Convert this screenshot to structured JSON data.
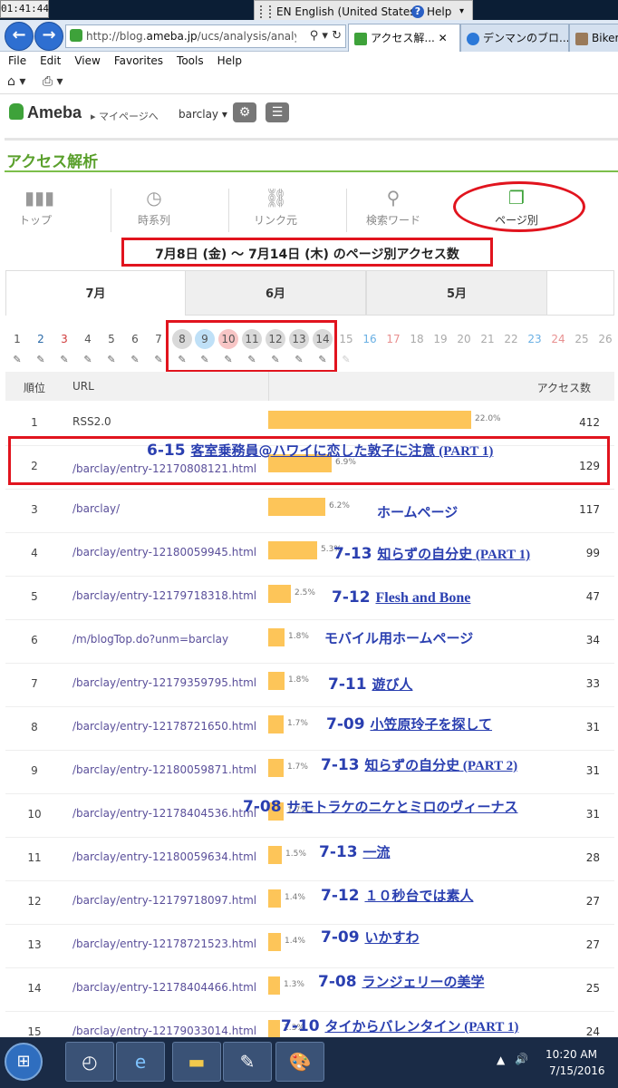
{
  "os": {
    "clock": "01:41:44",
    "language": "EN English (United States)",
    "help": "Help",
    "tray_time": "10:20 AM",
    "tray_date": "7/15/2016"
  },
  "browser": {
    "url_prefix": "http://blog.",
    "url_domain": "ameba.jp",
    "url_rest": "/ucs/analysis/analysis",
    "tabs": [
      "アクセス解...",
      "デンマンのブロ...",
      "Biker"
    ],
    "menu": [
      "File",
      "Edit",
      "View",
      "Favorites",
      "Tools",
      "Help"
    ]
  },
  "ameba": {
    "logo": "Ameba",
    "mypage": "マイページへ",
    "user": "barclay"
  },
  "page": {
    "title": "アクセス解析",
    "nav": [
      "トップ",
      "時系列",
      "リンク元",
      "検索ワード",
      "ページ別"
    ],
    "date_range": "7月8日 (金) 〜 7月14日 (木) のページ別アクセス数",
    "month_tabs": [
      "7月",
      "6月",
      "5月"
    ],
    "days": [
      "1",
      "2",
      "3",
      "4",
      "5",
      "6",
      "7",
      "8",
      "9",
      "10",
      "11",
      "12",
      "13",
      "14",
      "15",
      "16",
      "17",
      "18",
      "19",
      "20",
      "21",
      "22",
      "23",
      "24",
      "25",
      "26"
    ],
    "colors": {
      "accent_green": "#5aa02c",
      "bar": "#fdc559",
      "annotation_blue": "#2a3fb0",
      "highlight_red": "#e1141e"
    }
  },
  "table": {
    "headers": {
      "rank": "順位",
      "url": "URL",
      "count": "アクセス数"
    },
    "rows": [
      {
        "rank": "1",
        "url": "RSS2.0",
        "pct": "22.0%",
        "share": 22.0,
        "count": "412"
      },
      {
        "rank": "2",
        "url": "/barclay/entry-12170808121.html",
        "pct": "6.9%",
        "share": 6.9,
        "count": "129"
      },
      {
        "rank": "3",
        "url": "/barclay/",
        "pct": "6.2%",
        "share": 6.2,
        "count": "117"
      },
      {
        "rank": "4",
        "url": "/barclay/entry-12180059945.html",
        "pct": "5.3%",
        "share": 5.3,
        "count": "99"
      },
      {
        "rank": "5",
        "url": "/barclay/entry-12179718318.html",
        "pct": "2.5%",
        "share": 2.5,
        "count": "47"
      },
      {
        "rank": "6",
        "url": "/m/blogTop.do?unm=barclay",
        "pct": "1.8%",
        "share": 1.8,
        "count": "34"
      },
      {
        "rank": "7",
        "url": "/barclay/entry-12179359795.html",
        "pct": "1.8%",
        "share": 1.8,
        "count": "33"
      },
      {
        "rank": "8",
        "url": "/barclay/entry-12178721650.html",
        "pct": "1.7%",
        "share": 1.7,
        "count": "31"
      },
      {
        "rank": "9",
        "url": "/barclay/entry-12180059871.html",
        "pct": "1.7%",
        "share": 1.7,
        "count": "31"
      },
      {
        "rank": "10",
        "url": "/barclay/entry-12178404536.html",
        "pct": "1.7%",
        "share": 1.7,
        "count": "31"
      },
      {
        "rank": "11",
        "url": "/barclay/entry-12180059634.html",
        "pct": "1.5%",
        "share": 1.5,
        "count": "28"
      },
      {
        "rank": "12",
        "url": "/barclay/entry-12179718097.html",
        "pct": "1.4%",
        "share": 1.4,
        "count": "27"
      },
      {
        "rank": "13",
        "url": "/barclay/entry-12178721523.html",
        "pct": "1.4%",
        "share": 1.4,
        "count": "27"
      },
      {
        "rank": "14",
        "url": "/barclay/entry-12178404466.html",
        "pct": "1.3%",
        "share": 1.3,
        "count": "25"
      },
      {
        "rank": "15",
        "url": "/barclay/entry-12179033014.html",
        "pct": "1.3%",
        "share": 1.3,
        "count": "24"
      }
    ]
  },
  "annotations": [
    {
      "prefix": "6-15 ",
      "title": "客室乗務員@ハワイに恋した敦子に注意",
      "part": " (PART 1)"
    },
    {
      "prefix": "",
      "title": "ホームページ",
      "part": ""
    },
    {
      "prefix": "7-13 ",
      "title": "知らずの自分史",
      "part": " (PART 1)"
    },
    {
      "prefix": "7-12 ",
      "title": "Flesh and Bone",
      "part": ""
    },
    {
      "prefix": "",
      "title": "モバイル用ホームページ",
      "part": ""
    },
    {
      "prefix": "7-11 ",
      "title": "遊び人",
      "part": ""
    },
    {
      "prefix": "7-09 ",
      "title": "小笠原玲子を探して",
      "part": ""
    },
    {
      "prefix": "7-13 ",
      "title": "知らずの自分史",
      "part": " (PART 2)"
    },
    {
      "prefix": "7-08 ",
      "title": "サモトラケのニケとミロのヴィーナス",
      "part": ""
    },
    {
      "prefix": "7-13 ",
      "title": "一流",
      "part": ""
    },
    {
      "prefix": "7-12 ",
      "title": "１０秒台では素人",
      "part": ""
    },
    {
      "prefix": "7-09 ",
      "title": "いかすわ",
      "part": ""
    },
    {
      "prefix": "7-08 ",
      "title": "ランジェリーの美学",
      "part": ""
    },
    {
      "prefix": "7-10 ",
      "title": "タイからバレンタイン",
      "part": " (PART 1)"
    }
  ]
}
